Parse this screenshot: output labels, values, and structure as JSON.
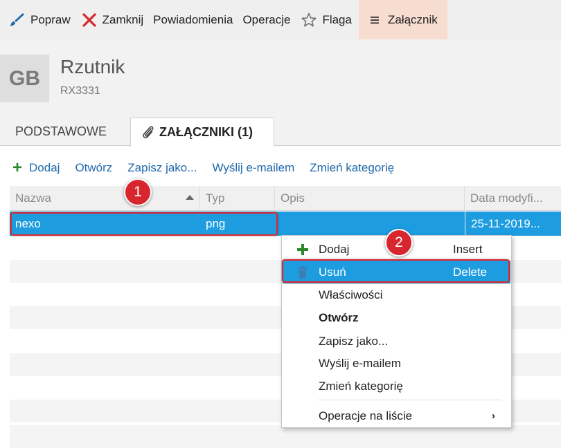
{
  "toolbar": {
    "items": [
      {
        "label": "Popraw",
        "icon": "brush-icon"
      },
      {
        "label": "Zamknij",
        "icon": "close-icon"
      },
      {
        "label": "Powiadomienia",
        "icon": ""
      },
      {
        "label": "Operacje",
        "icon": ""
      },
      {
        "label": "Flaga",
        "icon": "star-icon"
      },
      {
        "label": "Załącznik",
        "icon": "hamburger-icon"
      }
    ]
  },
  "header": {
    "avatar": "GB",
    "title": "Rzutnik",
    "subtitle": "RX3331"
  },
  "tabs": {
    "basic": "PODSTAWOWE",
    "attachments": "ZAŁĄCZNIKI (1)"
  },
  "actions": {
    "add": "Dodaj",
    "open": "Otwórz",
    "save_as": "Zapisz jako...",
    "email": "Wyślij e-mailem",
    "change_category": "Zmień kategorię"
  },
  "grid": {
    "columns": [
      "Nazwa",
      "Typ",
      "Opis",
      "Data modyfi..."
    ],
    "rows": [
      {
        "name": "nexo",
        "type": "png",
        "description": "",
        "modified": "25-11-2019..."
      }
    ]
  },
  "annotations": {
    "badge1": "1",
    "badge2": "2"
  },
  "context_menu": {
    "items": [
      {
        "label": "Dodaj",
        "shortcut": "Insert"
      },
      {
        "label": "Usuń",
        "shortcut": "Delete"
      },
      {
        "label": "Właściwości",
        "shortcut": ""
      },
      {
        "label": "Otwórz",
        "shortcut": ""
      },
      {
        "label": "Zapisz jako...",
        "shortcut": ""
      },
      {
        "label": "Wyślij e-mailem",
        "shortcut": ""
      },
      {
        "label": "Zmień kategorię",
        "shortcut": ""
      },
      {
        "label": "Operacje na liście",
        "shortcut": ""
      }
    ]
  },
  "colors": {
    "selection": "#1e9ce0",
    "link": "#1f6aab",
    "highlight": "#e0242c",
    "active_tab_bg": "#f7dcd0"
  }
}
